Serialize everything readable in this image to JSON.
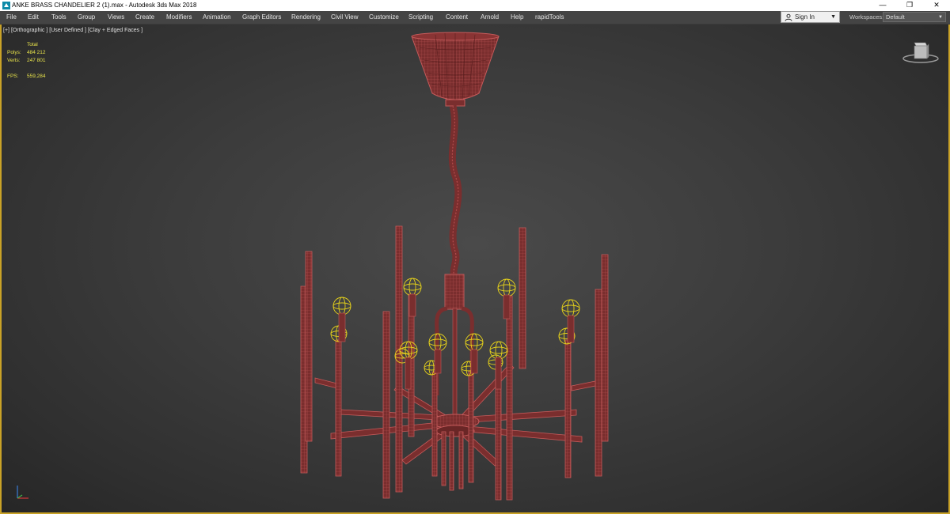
{
  "window": {
    "title": "ANKE BRASS CHANDELIER 2 (1).max - Autodesk 3ds Max 2018",
    "minimize_glyph": "—",
    "restore_glyph": "❐",
    "close_glyph": "✕"
  },
  "menu": {
    "items": [
      "File",
      "Edit",
      "Tools",
      "Group",
      "Views",
      "Create",
      "Modifiers",
      "Animation",
      "Graph Editors",
      "Rendering",
      "Civil View",
      "Customize",
      "Scripting",
      "Content",
      "Arnold",
      "Help",
      "rapidTools"
    ]
  },
  "account": {
    "sign_in_label": "Sign In"
  },
  "workspaces": {
    "label": "Workspaces:",
    "value": "Default"
  },
  "viewport": {
    "label_parts": [
      "[+]",
      "[Orthographic ]",
      "[User Defined ]",
      "[Clay + Edged Faces ]"
    ],
    "stats": {
      "header": "Total",
      "polys_label": "Polys:",
      "polys_value": "484 212",
      "verts_label": "Verts:",
      "verts_value": "247 801",
      "fps_label": "FPS:",
      "fps_value": "559,284"
    }
  },
  "colors": {
    "model_fill": "#7a2e2e",
    "model_edge": "#c45a5a",
    "bulb_wire": "#e6d21a",
    "selection_border": "#c9a227"
  },
  "icons": {
    "app": "3ds-max-logo-icon",
    "user": "user-icon",
    "viewcube": "viewcube-icon",
    "axis": "axis-tripod-icon"
  }
}
